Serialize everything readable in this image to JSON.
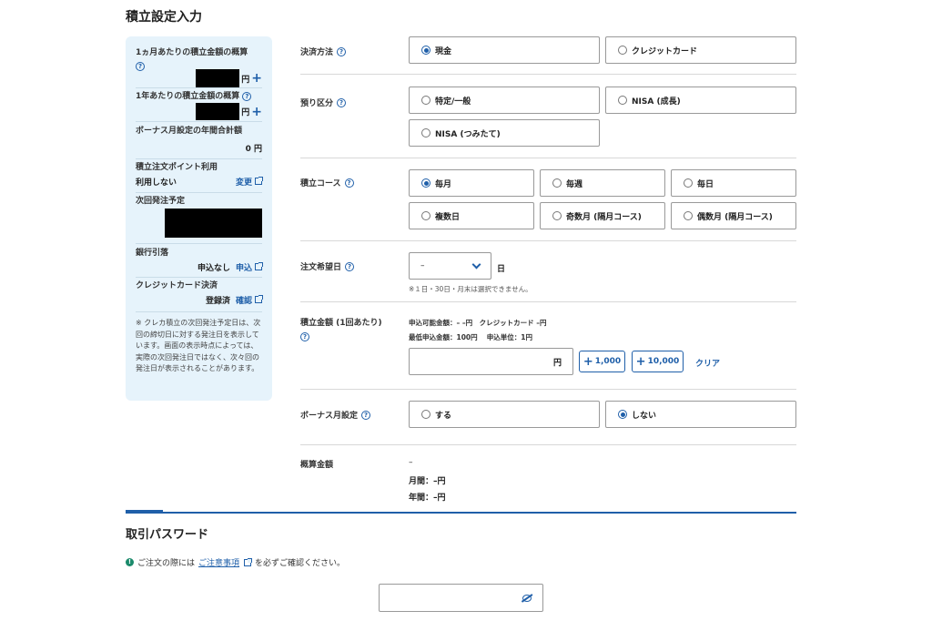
{
  "page_title": "積立設定入力",
  "summary": {
    "monthly_label": "1ヵ月あたりの積立金額の概算",
    "yearly_label": "1年あたりの積立金額の概算",
    "yen": "円",
    "bonus_label": "ボーナス月設定の年間合計額",
    "bonus_value": "0 円",
    "points_label": "積立注文ポイント利用",
    "points_value": "利用しない",
    "change_link": "変更",
    "next_order_label": "次回発注予定",
    "bank_label": "銀行引落",
    "bank_value": "申込なし",
    "bank_link": "申込",
    "card_label": "クレジットカード決済",
    "card_value": "登録済",
    "card_link": "確認",
    "note": "※ クレカ積立の次回発注予定日は、次回の締切日に対する発注日を表示しています。画面の表示時点によっては、実際の次回発注日ではなく、次々回の発注日が表示されることがあります。"
  },
  "form": {
    "payment": {
      "label": "決済方法",
      "options": [
        "現金",
        "クレジットカード"
      ],
      "selected": 0
    },
    "account": {
      "label": "預り区分",
      "options": [
        "特定/一般",
        "NISA (成長)",
        "NISA (つみたて)"
      ],
      "selected": -1
    },
    "course": {
      "label": "積立コース",
      "options": [
        "毎月",
        "毎週",
        "毎日",
        "複数日",
        "奇数月 (隔月コース)",
        "偶数月 (隔月コース)"
      ],
      "selected": 0
    },
    "order_day": {
      "label": "注文希望日",
      "value": "–",
      "unit": "日",
      "note": "※１日・30日・月末は選択できません。"
    },
    "amount": {
      "label": "積立金額 (1回あたり)",
      "available": "申込可能金額：– –円　クレジットカード –円",
      "minimum": "最低申込金額：100円　 申込単位：1円",
      "unit": "円",
      "add1": "1,000",
      "add2": "10,000",
      "clear": "クリア"
    },
    "bonus": {
      "label": "ボーナス月設定",
      "options": [
        "する",
        "しない"
      ],
      "selected": 1
    },
    "estimate": {
      "label": "概算金額",
      "value": "–",
      "monthly": "月間：–円",
      "yearly": "年間：–円"
    }
  },
  "password": {
    "title": "取引パスワード",
    "notice_before": "ご注文の際には",
    "notice_link": "ご注意事項",
    "notice_after": "を必ずご確認ください。"
  },
  "colors": {
    "accent": "#1f5fa9",
    "panel_bg": "#e6f3fb",
    "info": "#1b8a6b"
  }
}
